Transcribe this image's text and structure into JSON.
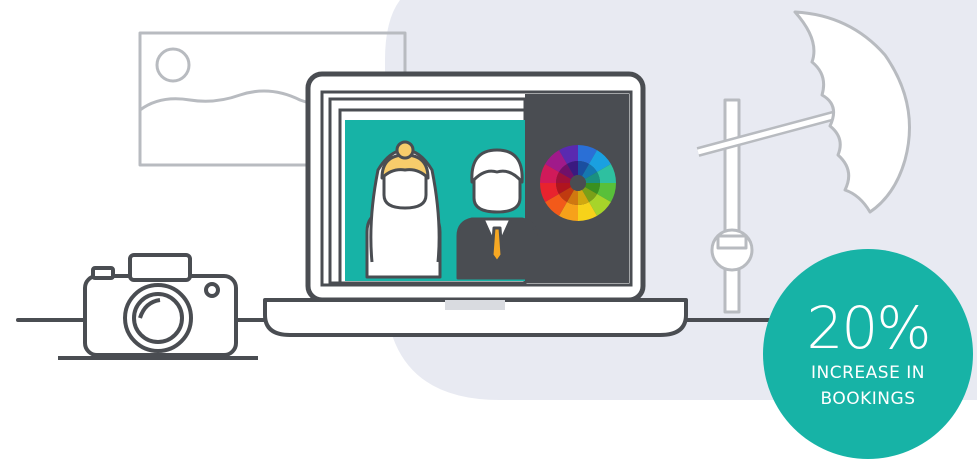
{
  "badge": {
    "value": "20%",
    "line1": "INCREASE IN",
    "line2": "BOOKINGS"
  },
  "colors": {
    "accent_teal": "#17b3a6",
    "outline_dark": "#4a4d52",
    "outline_light": "#b8bbc0",
    "backdrop": "#e8eaf2",
    "screen_dark": "#4a4d52",
    "hair_blonde": "#f7cc6b",
    "tie_orange": "#f7a823"
  },
  "icons": [
    "photo-frame-icon",
    "camera-icon",
    "laptop-icon",
    "bride-icon",
    "groom-icon",
    "color-wheel-icon",
    "light-stand-icon",
    "umbrella-reflector-icon"
  ]
}
